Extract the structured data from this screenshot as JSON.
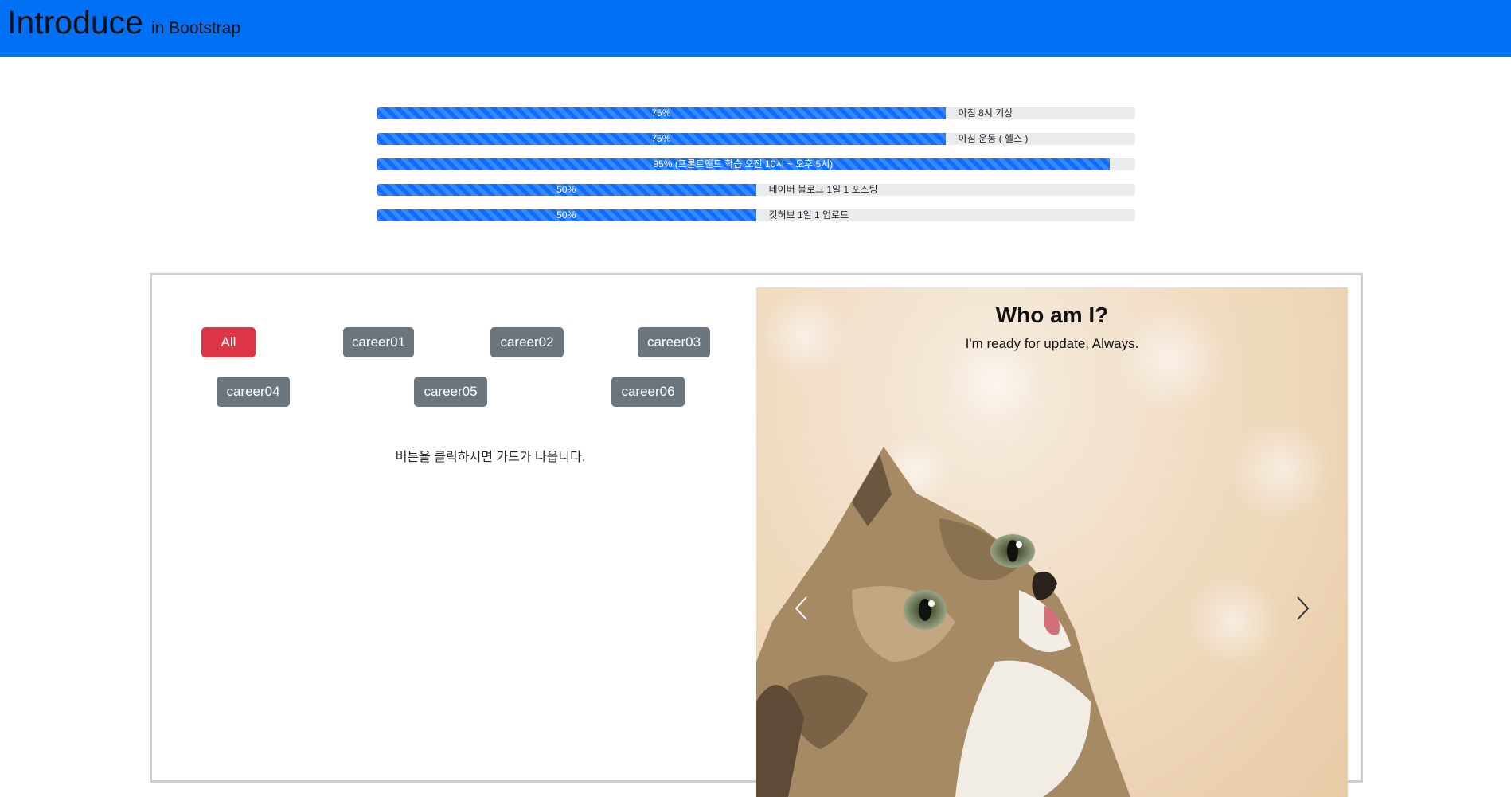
{
  "navbar": {
    "brand": "Introduce",
    "brand_sub": "in Bootstrap"
  },
  "progress": [
    {
      "percent": 75,
      "bar_text": "75%",
      "outside_text": "아침 8시 기상"
    },
    {
      "percent": 75,
      "bar_text": "75%",
      "outside_text": "아침 운동 ( 헬스 )"
    },
    {
      "percent": 96.6,
      "bar_text": "95% (프론트엔드 학습 오전 10시 ~ 오후 5시)",
      "outside_text": ""
    },
    {
      "percent": 50,
      "bar_text": "50%",
      "outside_text": "네이버 블로그 1일 1 포스팅"
    },
    {
      "percent": 50,
      "bar_text": "50%",
      "outside_text": "깃허브 1일 1 업로드"
    }
  ],
  "filters": {
    "all": "All",
    "career01": "career01",
    "career02": "career02",
    "career03": "career03",
    "career04": "career04",
    "career05": "career05",
    "career06": "career06"
  },
  "hint": "버튼을 클릭하시면 카드가 나옵니다.",
  "carousel": {
    "title": "Who am I?",
    "subtitle": "I'm ready for update, Always.",
    "image": "kitten-photo"
  },
  "colors": {
    "primary": "#0d6efd",
    "danger": "#dc3545",
    "secondary": "#6c757d"
  }
}
